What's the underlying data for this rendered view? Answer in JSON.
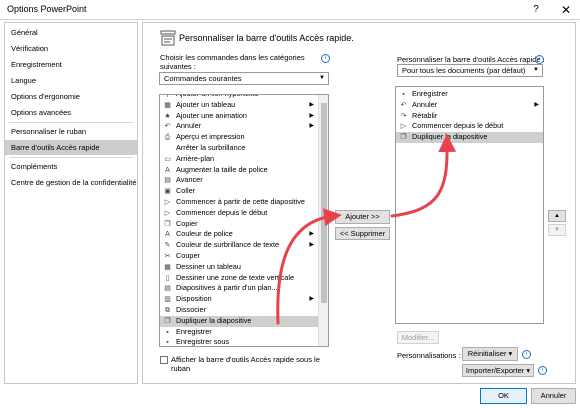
{
  "window": {
    "title": "Options PowerPoint",
    "help": "?",
    "close": "✕"
  },
  "nav": {
    "items": [
      {
        "label": "Général"
      },
      {
        "label": "Vérification"
      },
      {
        "label": "Enregistrement"
      },
      {
        "label": "Langue"
      },
      {
        "label": "Options d'ergonomie"
      },
      {
        "label": "Options avancées"
      },
      {
        "label": "Personnaliser le ruban"
      },
      {
        "label": "Barre d'outils Accès rapide",
        "selected": true
      },
      {
        "label": "Compléments"
      },
      {
        "label": "Centre de gestion de la confidentialité"
      }
    ]
  },
  "header": {
    "title": "Personnaliser la barre d'outils Accès rapide."
  },
  "left": {
    "choose_label": "Choisir les commandes dans les catégories suivantes :",
    "category_value": "Commandes courantes",
    "commands": [
      {
        "label": "Ajouter un lien hypertexte",
        "icon": "link-icon",
        "sub": false
      },
      {
        "label": "Ajouter un tableau",
        "icon": "table-icon",
        "sub": true
      },
      {
        "label": "Ajouter une animation",
        "icon": "star-icon",
        "sub": true
      },
      {
        "label": "Annuler",
        "icon": "undo-icon",
        "sub": true
      },
      {
        "label": "Aperçu et impression",
        "icon": "print-preview-icon",
        "sub": false
      },
      {
        "label": "Arrêter la surbrillance",
        "icon": "blank-icon",
        "sub": false
      },
      {
        "label": "Arrière-plan",
        "icon": "background-icon",
        "sub": false
      },
      {
        "label": "Augmenter la taille de police",
        "icon": "font-grow-icon",
        "sub": false
      },
      {
        "label": "Avancer",
        "icon": "bring-forward-icon",
        "sub": false
      },
      {
        "label": "Coller",
        "icon": "paste-icon",
        "sub": false
      },
      {
        "label": "Commencer à partir de cette diapositive",
        "icon": "play-current-icon",
        "sub": false
      },
      {
        "label": "Commencer depuis le début",
        "icon": "play-start-icon",
        "sub": false
      },
      {
        "label": "Copier",
        "icon": "copy-icon",
        "sub": false
      },
      {
        "label": "Couleur de police",
        "icon": "font-color-icon",
        "sub": true
      },
      {
        "label": "Couleur de surbrillance de texte",
        "icon": "highlight-icon",
        "sub": true
      },
      {
        "label": "Couper",
        "icon": "cut-icon",
        "sub": false
      },
      {
        "label": "Dessiner un tableau",
        "icon": "draw-table-icon",
        "sub": false
      },
      {
        "label": "Dessiner une zone de texte verticale",
        "icon": "vertical-textbox-icon",
        "sub": false
      },
      {
        "label": "Diapositives à partir d'un plan...",
        "icon": "slides-outline-icon",
        "sub": false
      },
      {
        "label": "Disposition",
        "icon": "layout-icon",
        "sub": true
      },
      {
        "label": "Dissocier",
        "icon": "ungroup-icon",
        "sub": false
      },
      {
        "label": "Dupliquer la diapositive",
        "icon": "duplicate-slide-icon",
        "sub": false,
        "selected": true
      },
      {
        "label": "Enregistrer",
        "icon": "save-icon",
        "sub": false
      },
      {
        "label": "Enregistrer sous",
        "icon": "save-as-icon",
        "sub": false
      }
    ],
    "show_below_label": "Afficher la barre d'outils Accès rapide sous le ruban"
  },
  "middle": {
    "add_label": "Ajouter >>",
    "remove_label": "<< Supprimer"
  },
  "right": {
    "customize_label": "Personnaliser la barre d'outils Accès rapide :",
    "scope_value": "Pour tous les documents (par défaut)",
    "items": [
      {
        "label": "Enregistrer",
        "icon": "save-icon",
        "sub": false
      },
      {
        "label": "Annuler",
        "icon": "undo-icon",
        "sub": true
      },
      {
        "label": "Rétablir",
        "icon": "redo-icon",
        "sub": false
      },
      {
        "label": "Commencer depuis le début",
        "icon": "play-start-icon",
        "sub": false
      },
      {
        "label": "Dupliquer la diapositive",
        "icon": "duplicate-slide-icon",
        "sub": false,
        "selected": true
      }
    ],
    "move_up": "▲",
    "move_down": "▼",
    "modify_label": "Modifier...",
    "personalizations_label": "Personnalisations :",
    "reset_label": "Réinitialiser ▾",
    "import_export_label": "Importer/Exporter ▾"
  },
  "footer": {
    "ok_label": "OK",
    "cancel_label": "Annuler"
  },
  "colors": {
    "annotation_arrow": "#e8434d",
    "selection": "#cfcfcf",
    "accent": "#0078d7"
  }
}
